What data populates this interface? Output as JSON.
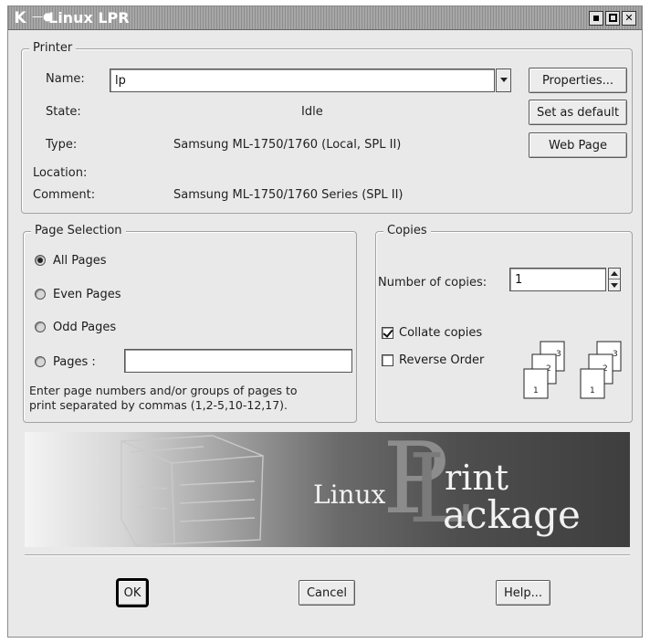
{
  "window": {
    "title": "Linux LPR",
    "app_icon": "K"
  },
  "printer": {
    "group_label": "Printer",
    "name_label": "Name:",
    "name_value": "lp",
    "state_label": "State:",
    "state_value": "Idle",
    "type_label": "Type:",
    "type_value": "Samsung ML-1750/1760 (Local, SPL II)",
    "location_label": "Location:",
    "location_value": "",
    "comment_label": "Comment:",
    "comment_value": "Samsung ML-1750/1760 Series (SPL II)",
    "properties_label": "Properties...",
    "set_default_label": "Set as default",
    "web_page_label": "Web Page"
  },
  "page_selection": {
    "group_label": "Page Selection",
    "all_pages": "All Pages",
    "even_pages": "Even Pages",
    "odd_pages": "Odd Pages",
    "pages": "Pages :",
    "pages_value": "",
    "selected": "all_pages",
    "help_line1": "Enter page numbers and/or groups of pages to",
    "help_line2": "print separated by commas (1,2-5,10-12,17)."
  },
  "copies": {
    "group_label": "Copies",
    "number_label": "Number of copies:",
    "number_value": "1",
    "collate_label": "Collate copies",
    "collate_checked": true,
    "reverse_label": "Reverse Order",
    "reverse_checked": false,
    "sheet_numbers": [
      "3",
      "2",
      "1"
    ]
  },
  "banner": {
    "word_linux": "Linux",
    "word_print": "rint",
    "word_package": "ackage"
  },
  "buttons": {
    "ok": "OK",
    "cancel": "Cancel",
    "help": "Help..."
  }
}
